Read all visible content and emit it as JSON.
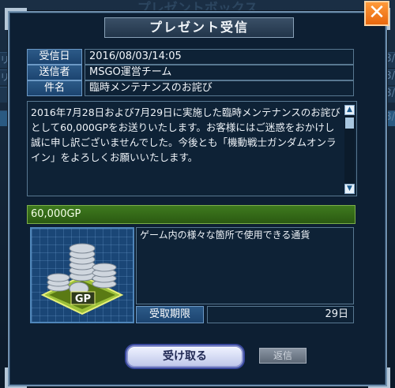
{
  "background": {
    "title": "プレゼントボックス",
    "fragment_left_1": "リー",
    "fragment_left_2": "リー",
    "date_fragment": "/03/"
  },
  "modal": {
    "title": "プレゼント受信",
    "close_label": "✕"
  },
  "info": {
    "received_label": "受信日",
    "received_value": "2016/08/03/14:05",
    "sender_label": "送信者",
    "sender_value": "MSGO運営チーム",
    "subject_label": "件名",
    "subject_value": "臨時メンテナンスのお詫び"
  },
  "message": {
    "body": "2016年7月28日および7月29日に実施した臨時メンテナンスのお詫びとして60,000GPをお送りいたします。お客様にはご迷惑をおかけし誠に申し訳ございませんでした。今後とも「機動戦士ガンダムオンライン」をよろしくお願いいたします。",
    "scroll_up": "▲",
    "scroll_down": "▼"
  },
  "item": {
    "name": "60,000GP",
    "icon_label": "GP",
    "description": "ゲーム内の様々な箇所で使用できる通貨",
    "deadline_label": "受取期限",
    "deadline_value": "29日"
  },
  "buttons": {
    "receive": "受け取る",
    "reply": "返信"
  },
  "colors": {
    "accent": "#e8670e",
    "item_header": "#3e7a1e",
    "label_blue": "#2c5a88"
  }
}
